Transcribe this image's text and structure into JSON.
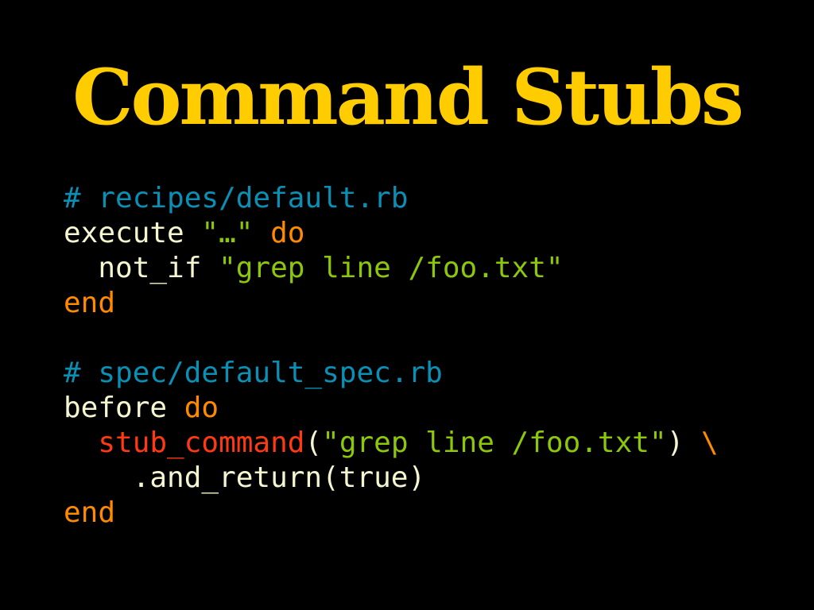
{
  "slide": {
    "title": "Command Stubs",
    "colors": {
      "title": "#ffcc00",
      "comment": "#0a8fb5",
      "plain": "#f5f5d0",
      "string": "#8cc70a",
      "keyword": "#ff8a00",
      "method": "#ff3a12",
      "background": "#000000"
    },
    "code_lines": [
      [
        {
          "type": "comment",
          "text": "# recipes/default.rb"
        }
      ],
      [
        {
          "type": "plain",
          "text": "execute "
        },
        {
          "type": "string",
          "text": "\"…\""
        },
        {
          "type": "plain",
          "text": " "
        },
        {
          "type": "keyword",
          "text": "do"
        }
      ],
      [
        {
          "type": "plain",
          "text": "  not_if "
        },
        {
          "type": "string",
          "text": "\"grep line /foo.txt\""
        }
      ],
      [
        {
          "type": "keyword",
          "text": "end"
        }
      ],
      [],
      [
        {
          "type": "comment",
          "text": "# spec/default_spec.rb"
        }
      ],
      [
        {
          "type": "plain",
          "text": "before "
        },
        {
          "type": "keyword",
          "text": "do"
        }
      ],
      [
        {
          "type": "plain",
          "text": "  "
        },
        {
          "type": "method",
          "text": "stub_command"
        },
        {
          "type": "plain",
          "text": "("
        },
        {
          "type": "string",
          "text": "\"grep line /foo.txt\""
        },
        {
          "type": "plain",
          "text": ") "
        },
        {
          "type": "keyword",
          "text": "\\"
        }
      ],
      [
        {
          "type": "plain",
          "text": "    .and_return(true)"
        }
      ],
      [
        {
          "type": "keyword",
          "text": "end"
        }
      ]
    ]
  }
}
